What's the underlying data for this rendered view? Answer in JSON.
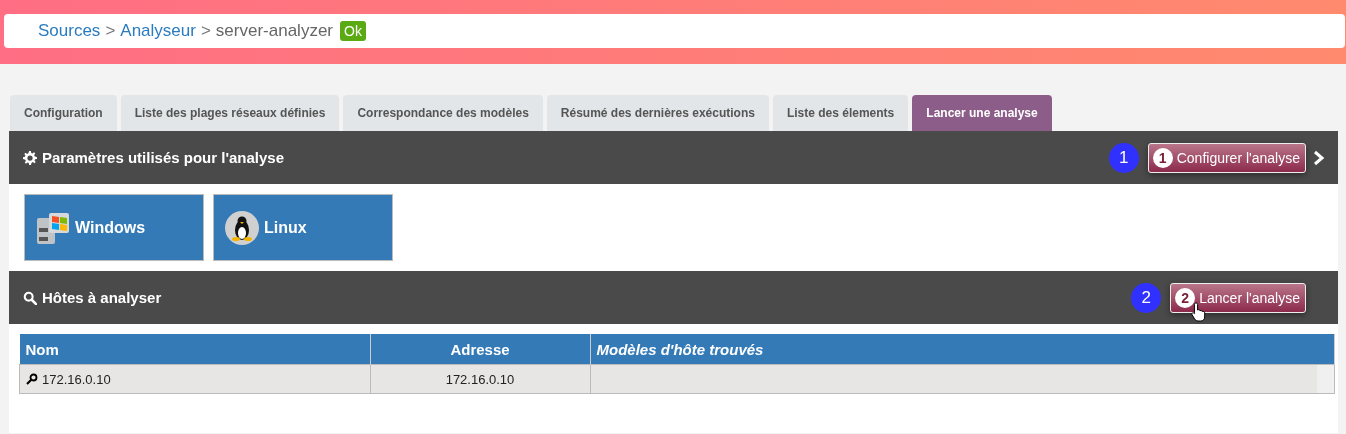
{
  "breadcrumb": {
    "items": [
      {
        "label": "Sources",
        "kind": "link",
        "separator": ">"
      },
      {
        "label": "Analyseur",
        "kind": "link",
        "separator": ">"
      },
      {
        "label": "server-analyzer",
        "kind": "current"
      }
    ],
    "status_badge": "Ok"
  },
  "tabs": [
    {
      "label": "Configuration",
      "selected": false
    },
    {
      "label": "Liste des plages réseaux définies",
      "selected": false
    },
    {
      "label": "Correspondance des modèles",
      "selected": false
    },
    {
      "label": "Résumé des dernières exécutions",
      "selected": false
    },
    {
      "label": "Liste des élements",
      "selected": false
    },
    {
      "label": "Lancer une analyse",
      "selected": true
    }
  ],
  "sections": [
    {
      "kind": "os_choice",
      "title": "Paramètres utilisés pour l'analyse",
      "step_badge": "1",
      "button": {
        "step": "1",
        "label": "Configurer l'analyse"
      },
      "has_next": true,
      "os_buttons": [
        {
          "label": "Windows"
        },
        {
          "label": "Linux"
        }
      ]
    },
    {
      "kind": "hosts",
      "title": "Hôtes à analyser",
      "step_badge": "2",
      "button": {
        "step": "2",
        "label": "Lancer l'analyse"
      },
      "has_next": false,
      "table": {
        "columns": [
          "Nom",
          "Adresse",
          "Modèles d'hôte trouvés"
        ],
        "rows": [
          {
            "name": "172.16.0.10",
            "address": "172.16.0.10"
          }
        ]
      }
    }
  ]
}
